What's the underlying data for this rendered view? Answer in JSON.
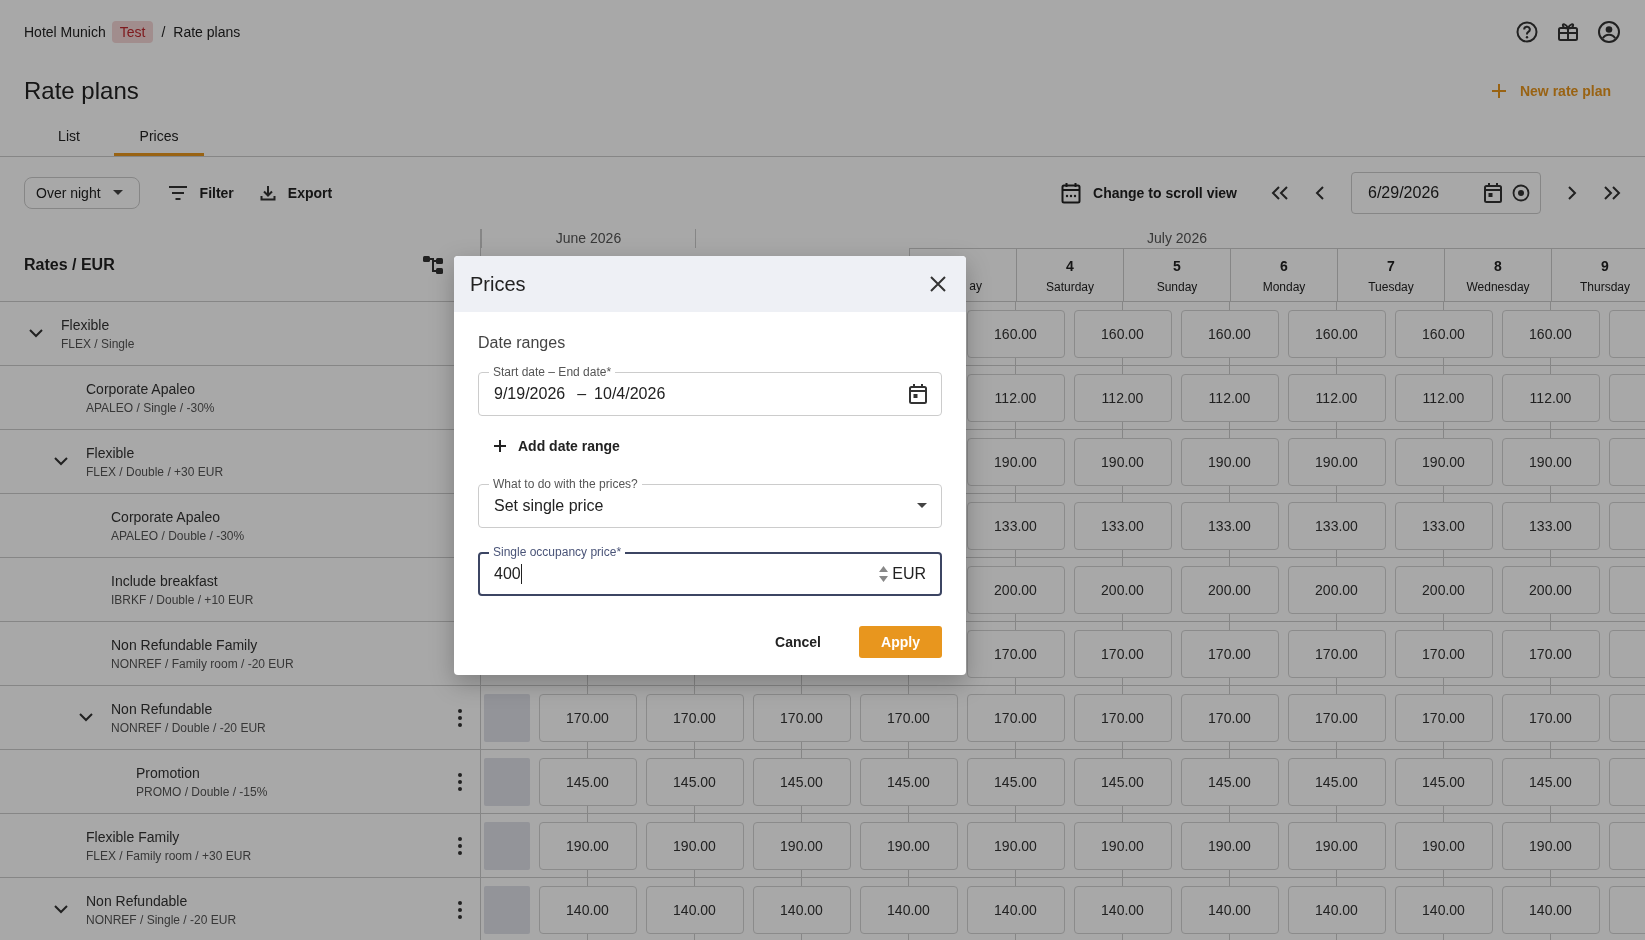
{
  "breadcrumb": {
    "hotel": "Hotel Munich",
    "badge": "Test",
    "separator": "/",
    "page": "Rate plans"
  },
  "page_title": "Rate plans",
  "new_button": "New rate plan",
  "tabs": [
    {
      "label": "List",
      "selected": false
    },
    {
      "label": "Prices",
      "selected": true
    }
  ],
  "toolbar": {
    "mode": "Over night",
    "filter": "Filter",
    "export": "Export",
    "scroll_view": "Change to scroll view",
    "date": "6/29/2026"
  },
  "rates_header": "Rates / EUR",
  "months": [
    "June 2026",
    "July 2026"
  ],
  "days": [
    {
      "name": "ay"
    },
    {
      "number": "4",
      "name": "Saturday"
    },
    {
      "number": "5",
      "name": "Sunday"
    },
    {
      "number": "6",
      "name": "Monday"
    },
    {
      "number": "7",
      "name": "Tuesday"
    },
    {
      "number": "8",
      "name": "Wednesday"
    },
    {
      "number": "9",
      "name": "Thursday"
    }
  ],
  "rates": [
    {
      "name": "Flexible",
      "code": "FLEX / Single",
      "expanded": true,
      "menu": false,
      "prices": [
        "160.00",
        "160.00",
        "160.00",
        "160.00",
        "160.00",
        "160.00"
      ],
      "children": [
        {
          "name": "Corporate Apaleo",
          "code": "APALEO / Single / -30%",
          "menu": false,
          "prices": [
            "112.00",
            "112.00",
            "112.00",
            "112.00",
            "112.00",
            "112.00"
          ]
        },
        {
          "name": "Flexible",
          "code": "FLEX / Double / +30 EUR",
          "expanded": true,
          "menu": false,
          "prices": [
            "190.00",
            "190.00",
            "190.00",
            "190.00",
            "190.00",
            "190.00"
          ],
          "children": [
            {
              "name": "Corporate Apaleo",
              "code": "APALEO / Double / -30%",
              "menu": false,
              "prices": [
                "133.00",
                "133.00",
                "133.00",
                "133.00",
                "133.00",
                "133.00"
              ]
            },
            {
              "name": "Include breakfast",
              "code": "IBRKF / Double / +10 EUR",
              "menu": false,
              "prices": [
                "200.00",
                "200.00",
                "200.00",
                "200.00",
                "200.00",
                "200.00"
              ]
            },
            {
              "name": "Non Refundable Family",
              "code": "NONREF / Family room / -20 EUR",
              "menu": false,
              "prices": [
                "170.00",
                "170.00",
                "170.00",
                "170.00",
                "170.00",
                "170.00"
              ]
            },
            {
              "name": "Non Refundable",
              "code": "NONREF / Double / -20 EUR",
              "expanded": true,
              "menu": true,
              "prices": [
                "170.00",
                "170.00",
                "170.00",
                "170.00",
                "170.00",
                "170.00",
                "170.00",
                "170.00",
                "170.00",
                "170.00"
              ],
              "children": [
                {
                  "name": "Promotion",
                  "code": "PROMO / Double / -15%",
                  "menu": true,
                  "prices": [
                    "145.00",
                    "145.00",
                    "145.00",
                    "145.00",
                    "145.00",
                    "145.00",
                    "145.00",
                    "145.00",
                    "145.00",
                    "145.00"
                  ]
                }
              ]
            }
          ]
        },
        {
          "name": "Flexible Family",
          "code": "FLEX / Family room / +30 EUR",
          "menu": true,
          "prices": [
            "190.00",
            "190.00",
            "190.00",
            "190.00",
            "190.00",
            "190.00",
            "190.00",
            "190.00",
            "190.00",
            "190.00"
          ]
        },
        {
          "name": "Non Refundable",
          "code": "NONREF / Single / -20 EUR",
          "expanded": true,
          "menu": true,
          "prices": [
            "140.00",
            "140.00",
            "140.00",
            "140.00",
            "140.00",
            "140.00",
            "140.00",
            "140.00",
            "140.00",
            "140.00"
          ]
        }
      ]
    }
  ],
  "dialog": {
    "title": "Prices",
    "section": "Date ranges",
    "date_range": {
      "label": "Start date – End date*",
      "start": "9/19/2026",
      "separator": "–",
      "end": "10/4/2026"
    },
    "add_range": "Add date range",
    "action": {
      "label": "What to do with the prices?",
      "value": "Set single price"
    },
    "price": {
      "label": "Single occupancy price*",
      "value": "400",
      "unit": "EUR",
      "focused": true
    },
    "cancel": "Cancel",
    "apply": "Apply"
  }
}
